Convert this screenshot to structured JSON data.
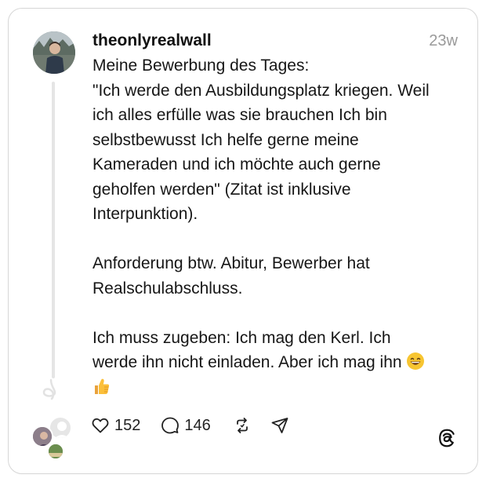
{
  "post": {
    "username": "theonlyrealwall",
    "timestamp": "23w",
    "lines": [
      "Meine Bewerbung des Tages:",
      "\"Ich werde den Ausbildungsplatz kriegen. Weil",
      "ich alles erfülle was sie brauchen Ich bin",
      "selbstbewusst Ich helfe gerne meine",
      "Kameraden und ich möchte auch gerne",
      "geholfen werden\" (Zitat ist inklusive",
      "Interpunktion).",
      "",
      "Anforderung btw. Abitur, Bewerber hat",
      "Realschulabschluss.",
      "",
      "Ich muss zugeben: Ich mag den Kerl. Ich",
      "werde ihn nicht einladen. Aber ich mag ihn"
    ],
    "emojis": [
      "grinning-face-emoji",
      "thumbs-up-emoji"
    ]
  },
  "actions": {
    "likes": "152",
    "replies": "146"
  },
  "icons": [
    "heart-icon",
    "comment-icon",
    "repost-icon",
    "share-icon",
    "threads-logo-icon"
  ],
  "colors": {
    "text": "#161616",
    "muted": "#9a9a9a",
    "border": "#d6d6d6",
    "thread_line": "#e5e5e5"
  }
}
